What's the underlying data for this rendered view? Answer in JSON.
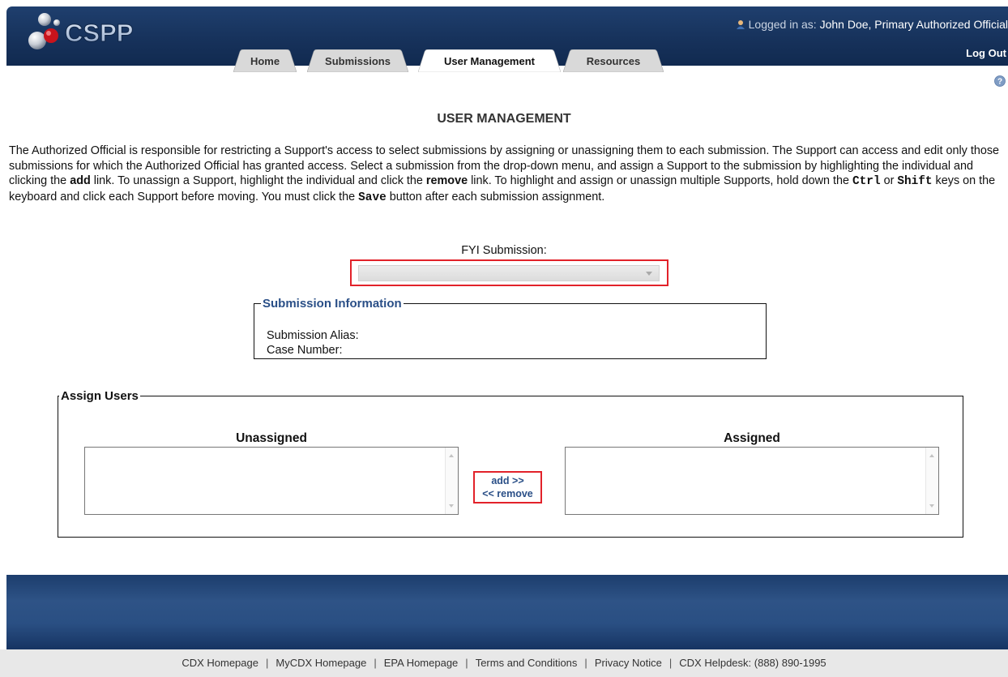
{
  "header": {
    "logo_text": "CSPP",
    "logged_in_prefix": "Logged in as: ",
    "logged_in_user": "John Doe, Primary Authorized Official",
    "logout_label": "Log Out",
    "tabs": [
      {
        "label": "Home",
        "active": false
      },
      {
        "label": "Submissions",
        "active": false
      },
      {
        "label": "User Management",
        "active": true
      },
      {
        "label": "Resources",
        "active": false
      }
    ]
  },
  "page": {
    "title": "USER MANAGEMENT",
    "intro_parts": [
      "The Authorized Official is responsible for restricting a Support's access to select submissions by assigning or unassigning them to each submission. The Support can access and edit only those submissions for which the Authorized Official has granted access. Select a submission from the drop-down menu, and assign a Support to the submission by highlighting the individual and clicking the ",
      "add",
      " link. To unassign a Support, highlight the individual and click the ",
      "remove",
      " link. To highlight and assign or unassign multiple Supports, hold down the ",
      "Ctrl",
      " or ",
      "Shift",
      " keys on the keyboard and click each Support before moving. You must click the ",
      "Save",
      " button after each submission assignment."
    ]
  },
  "fyi": {
    "label": "FYI Submission:",
    "selected_value": ""
  },
  "submission_info": {
    "legend": "Submission Information",
    "alias_label": "Submission Alias:",
    "case_label": "Case Number:"
  },
  "assign_users": {
    "legend": "Assign Users",
    "unassigned_header": "Unassigned",
    "assigned_header": "Assigned",
    "add_label": "add >>",
    "remove_label": "<< remove"
  },
  "footer": {
    "links": [
      "CDX Homepage",
      "MyCDX Homepage",
      "EPA Homepage",
      "Terms and Conditions",
      "Privacy Notice",
      "CDX Helpdesk: (888) 890-1995"
    ],
    "separator": "|"
  },
  "colors": {
    "header_bg": "#1a3763",
    "highlight_border": "#e2222a",
    "link_blue": "#2a4f87",
    "footer_bar": "#e8e8e8"
  }
}
